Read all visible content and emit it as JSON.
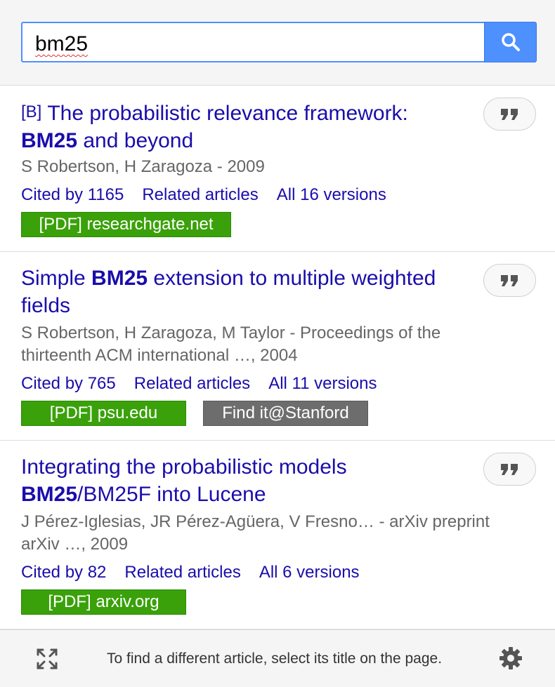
{
  "search": {
    "query": "bm25",
    "button_icon": "search-icon"
  },
  "results": [
    {
      "tag": "[B]",
      "title_part1": "The probabilistic relevance framework:",
      "title_bold": "BM25",
      "title_part2": " and beyond",
      "authors": "S Robertson, H Zaragoza - 2009",
      "cited_by": "Cited by 1165",
      "related": "Related articles",
      "versions": "All 16 versions",
      "pdf_label": "[PDF] researchgate.net",
      "cite_icon": "quote-icon"
    },
    {
      "title_part1": "Simple ",
      "title_bold": "BM25",
      "title_part2": " extension to multiple weighted fields",
      "authors": "S Robertson, H Zaragoza, M Taylor - Proceedings of the thirteenth ACM international …, 2004",
      "cited_by": "Cited by 765",
      "related": "Related articles",
      "versions": "All 11 versions",
      "pdf_label": "[PDF] psu.edu",
      "findit_label": "Find it@Stanford",
      "cite_icon": "quote-icon"
    },
    {
      "title_part1": "Integrating the probabilistic models ",
      "title_bold": "BM25",
      "title_part2": "/BM25F into Lucene",
      "authors": "J Pérez-Iglesias, JR Pérez-Agüera, V Fresno… - arXiv preprint arXiv …, 2009",
      "cited_by": "Cited by 82",
      "related": "Related articles",
      "versions": "All 6 versions",
      "pdf_label": "[PDF] arxiv.org",
      "cite_icon": "quote-icon"
    }
  ],
  "footer": {
    "hint": "To find a different article, select its title on the page.",
    "left_icon": "fullscreen-icon",
    "right_icon": "gear-icon"
  },
  "colors": {
    "link": "#1a0dab",
    "accent": "#4d90fe",
    "pdf_green": "#3aa10a",
    "findit_gray": "#6d6d6d"
  }
}
